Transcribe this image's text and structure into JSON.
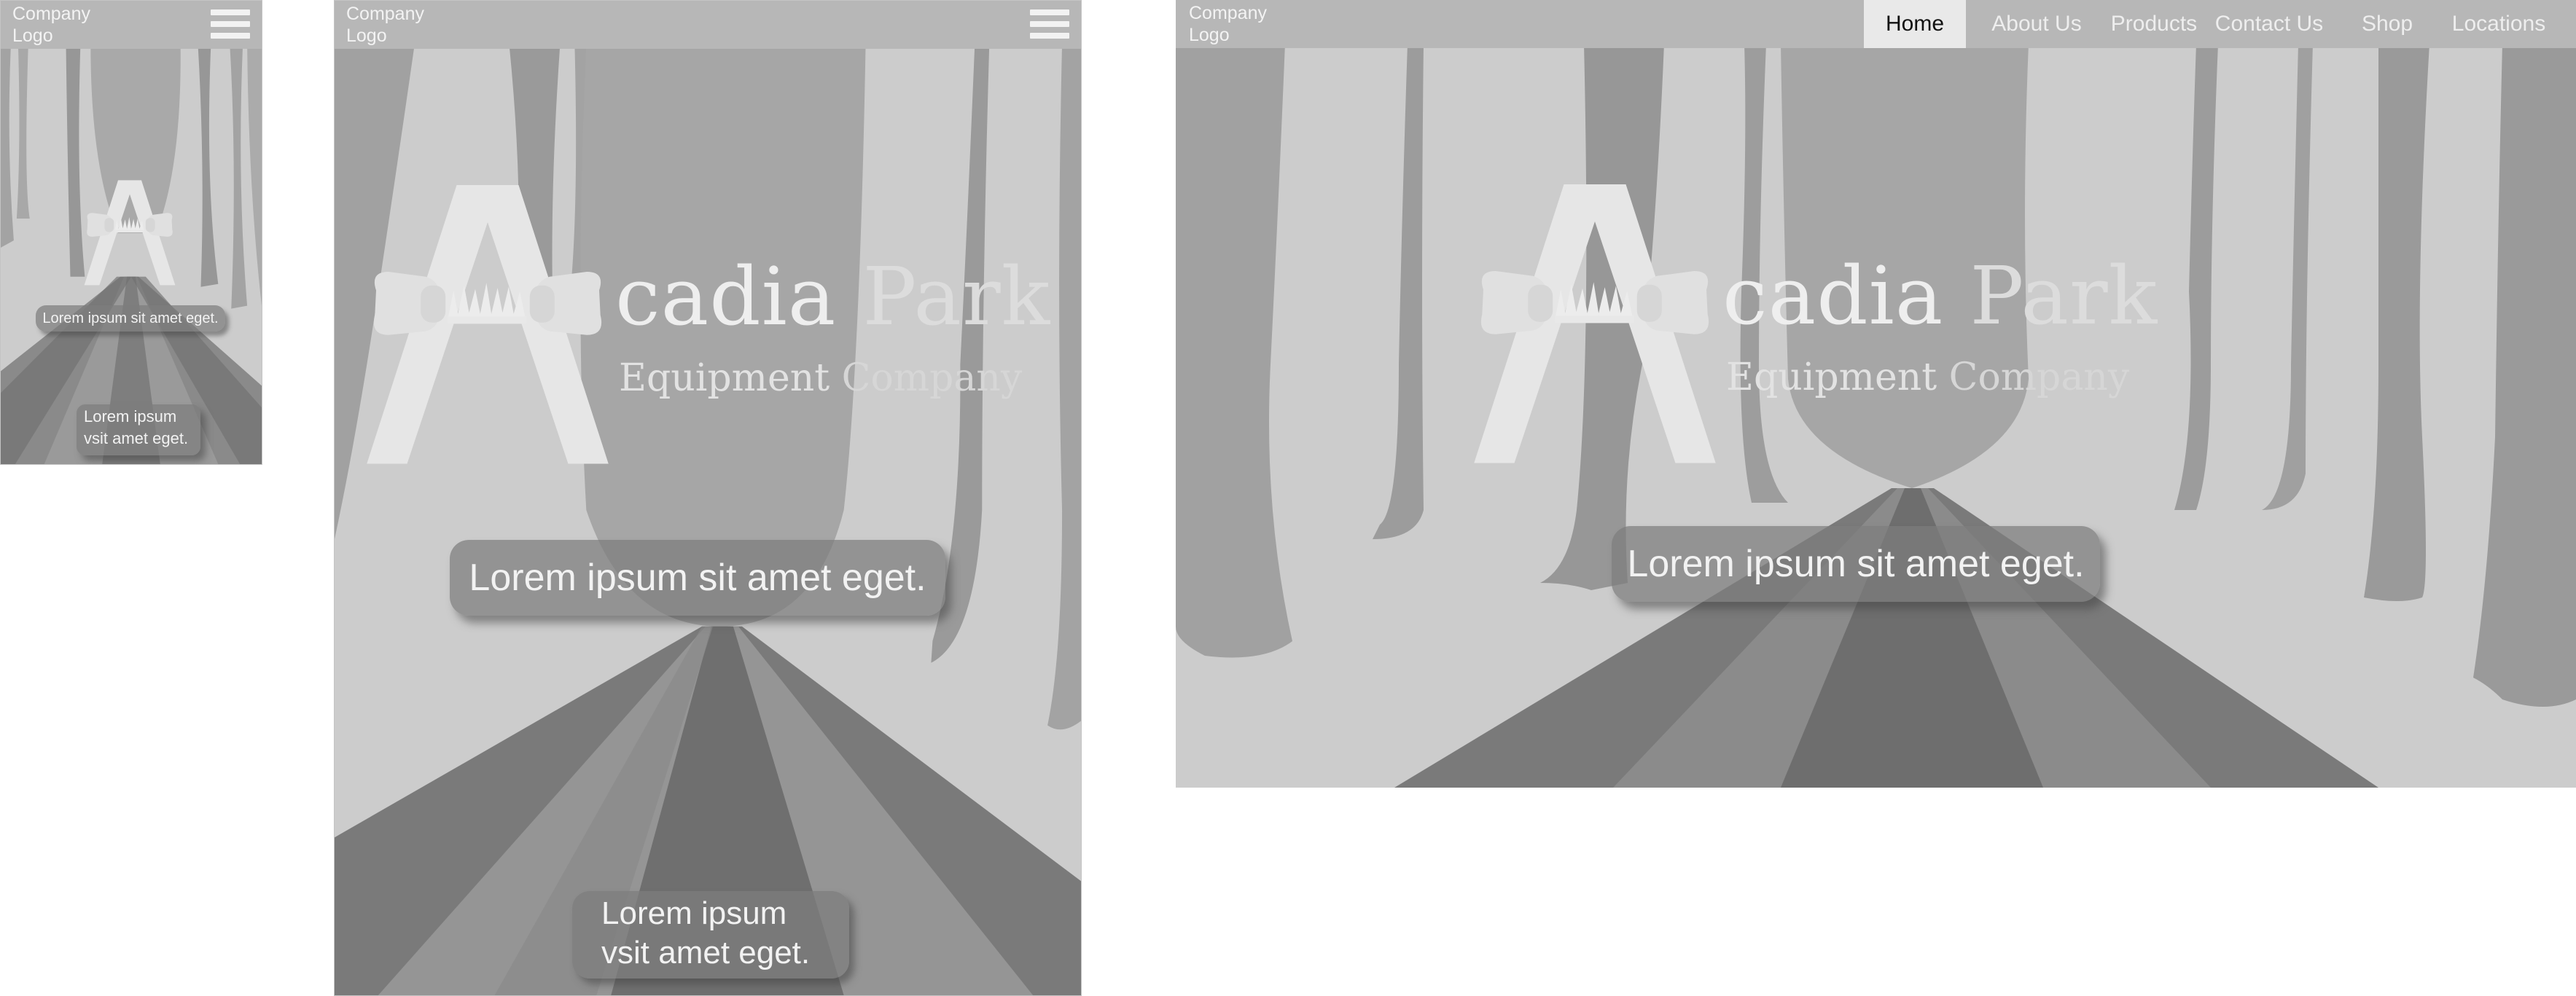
{
  "header": {
    "company_logo": "Company Logo"
  },
  "nav": {
    "items": [
      {
        "label": "Home",
        "active": true
      },
      {
        "label": "About Us",
        "active": false
      },
      {
        "label": "Products",
        "active": false
      },
      {
        "label": "Contact Us",
        "active": false
      },
      {
        "label": "Shop",
        "active": false
      },
      {
        "label": "Locations",
        "active": false
      }
    ]
  },
  "brand": {
    "name_part1": "cadia",
    "name_part2": "Park",
    "sub_part1": "Equipment",
    "sub_part2": "Company"
  },
  "hero": {
    "tagline": "Lorem ipsum sit amet eget.",
    "secondary_line1": "Lorem ipsum",
    "secondary_line2": "vsit amet eget."
  },
  "colors": {
    "header_bg": "#b7b7b7",
    "scene_bg": "#cccccc",
    "active_nav_bg": "#e9e9e9",
    "tree_dark": "#979797",
    "tree_mid": "#a3a3a3"
  },
  "icons": {
    "menu": "hamburger-menu-icon",
    "brand_mark": "acadia-a-mark-icon"
  }
}
